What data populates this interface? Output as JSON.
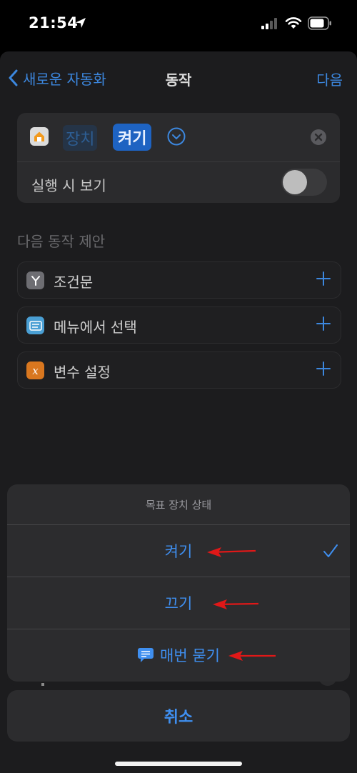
{
  "status": {
    "time": "21:54"
  },
  "nav": {
    "back": "새로운 자동화",
    "title": "동작",
    "next": "다음"
  },
  "action_card": {
    "device_chip": "장치",
    "state_chip": "켜기",
    "show_when_run_label": "실행 시 보기",
    "show_when_run_on": false
  },
  "suggestions": {
    "header": "다음 동작 제안",
    "items": [
      {
        "label": "조건문",
        "icon": "if-branch-icon",
        "color": "#6e6e73"
      },
      {
        "label": "메뉴에서 선택",
        "icon": "menu-icon",
        "color": "#4a9fd4"
      },
      {
        "label": "변수 설정",
        "icon": "variable-x-icon",
        "color": "#d9771f"
      }
    ]
  },
  "action_sheet": {
    "title": "목표 장치 상태",
    "options": [
      {
        "label": "켜기",
        "selected": true
      },
      {
        "label": "끄기",
        "selected": false
      },
      {
        "label": "매번 묻기",
        "selected": false
      }
    ],
    "cancel": "취소"
  },
  "colors": {
    "accent": "#3f8ff0",
    "annotation_arrow": "#e01818"
  }
}
